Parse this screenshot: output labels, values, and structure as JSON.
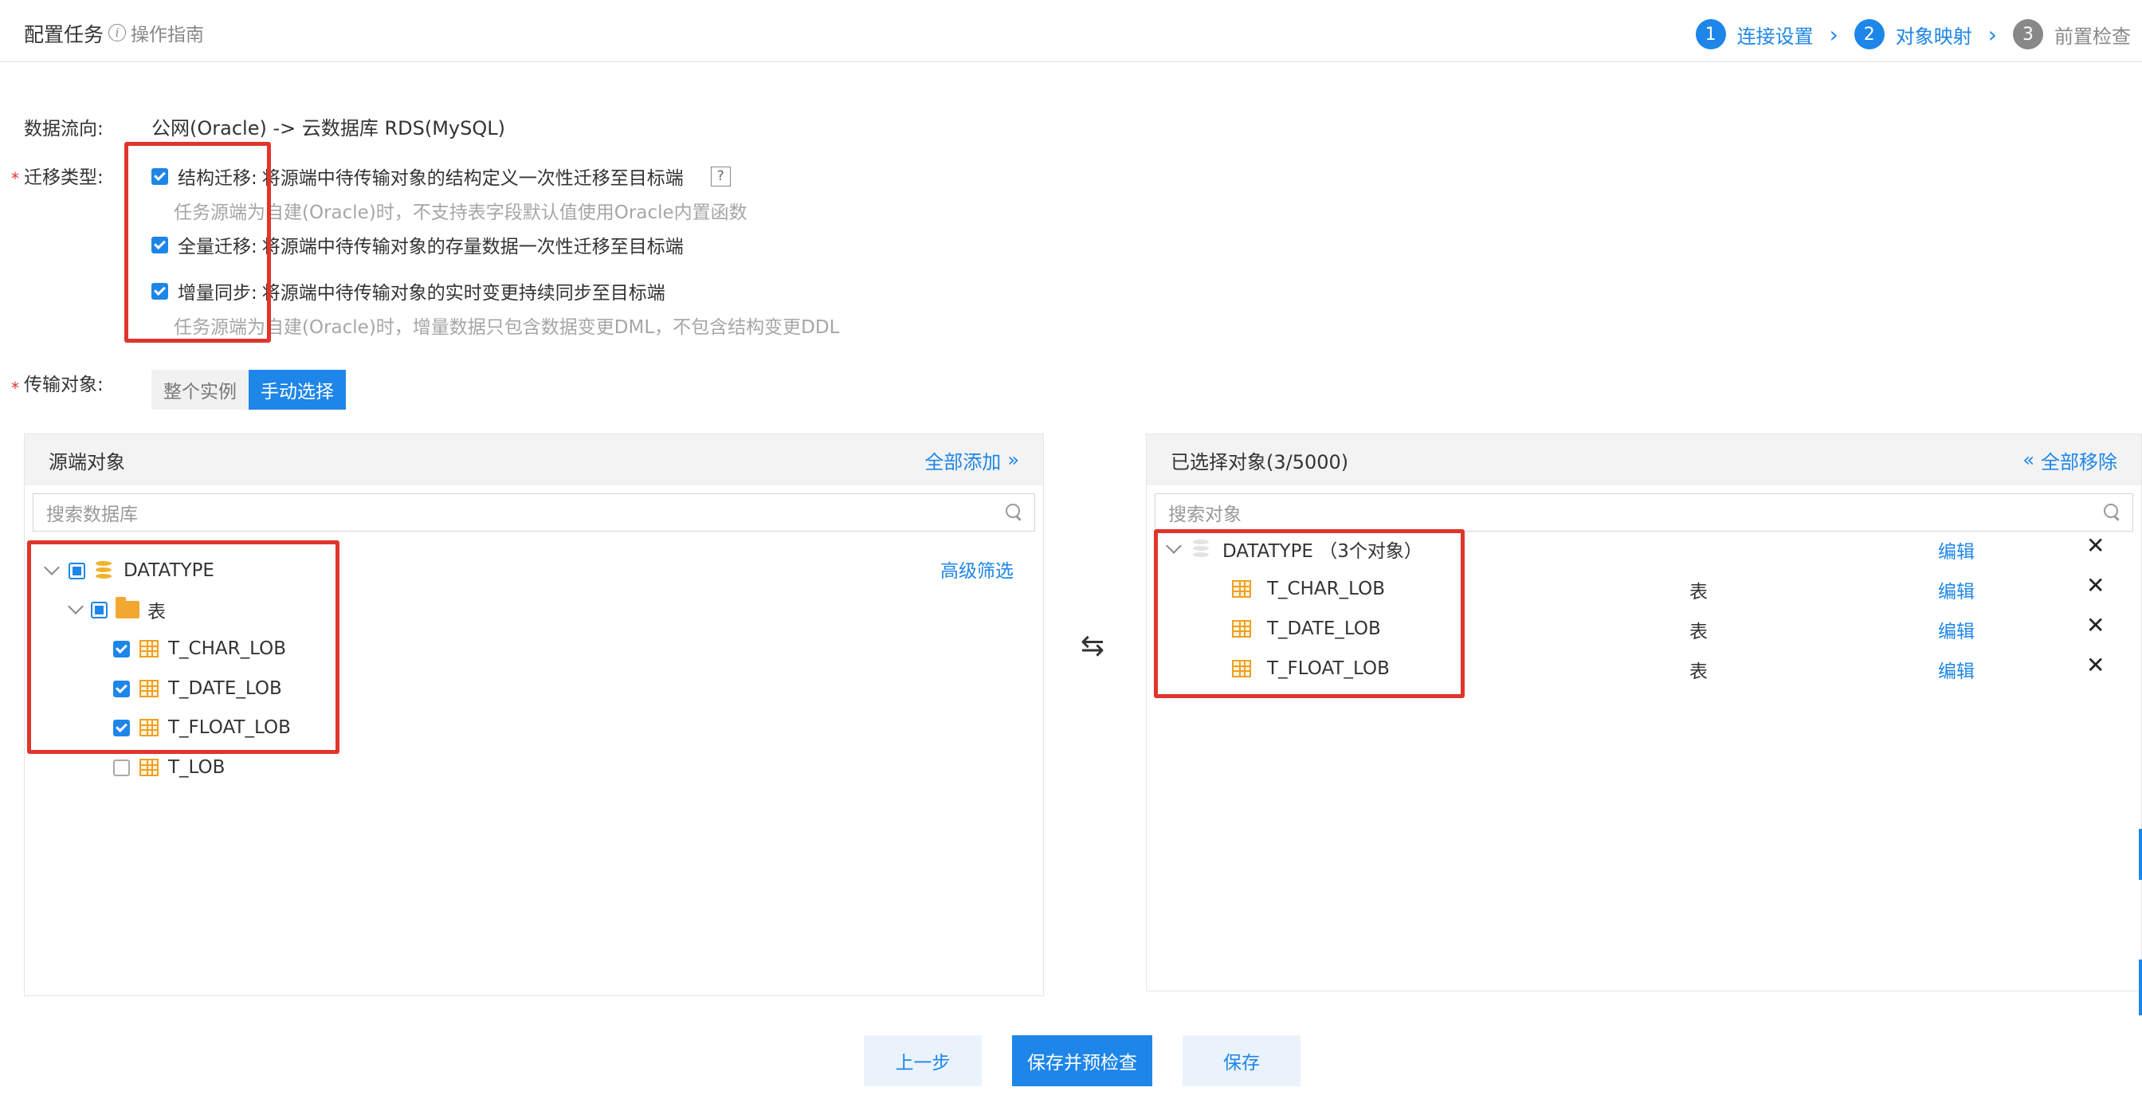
{
  "header": {
    "title": "配置任务",
    "guide": "操作指南",
    "steps": [
      {
        "num": "1",
        "label": "连接设置"
      },
      {
        "num": "2",
        "label": "对象映射"
      },
      {
        "num": "3",
        "label": "前置检查"
      }
    ]
  },
  "form": {
    "flow_label": "数据流向:",
    "flow_value": "公网(Oracle) -> 云数据库 RDS(MySQL)",
    "migration_label": "迁移类型:",
    "options": [
      {
        "label": "结构迁移:",
        "desc": "将源端中待传输对象的结构定义一次性迁移至目标端",
        "hint": "任务源端为自建(Oracle)时，不支持表字段默认值使用Oracle内置函数"
      },
      {
        "label": "全量迁移:",
        "desc": "将源端中待传输对象的存量数据一次性迁移至目标端",
        "hint": ""
      },
      {
        "label": "增量同步:",
        "desc": "将源端中待传输对象的实时变更持续同步至目标端",
        "hint": "任务源端为自建(Oracle)时，增量数据只包含数据变更DML，不包含结构变更DDL"
      }
    ],
    "help_mark": "?",
    "object_label": "传输对象:",
    "object_modes": [
      "整个实例",
      "手动选择"
    ]
  },
  "source": {
    "title": "源端对象",
    "add_all": "全部添加",
    "search_placeholder": "搜索数据库",
    "filter": "高级筛选",
    "db": "DATATYPE",
    "folder": "表",
    "tables": [
      {
        "name": "T_CHAR_LOB",
        "checked": true
      },
      {
        "name": "T_DATE_LOB",
        "checked": true
      },
      {
        "name": "T_FLOAT_LOB",
        "checked": true
      },
      {
        "name": "T_LOB",
        "checked": false
      }
    ]
  },
  "target": {
    "title": "已选择对象(3/5000)",
    "remove_all": "全部移除",
    "search_placeholder": "搜索对象",
    "db": "DATATYPE （3个对象）",
    "edit": "编辑",
    "items": [
      {
        "name": "T_CHAR_LOB",
        "type": "表",
        "edit": "编辑"
      },
      {
        "name": "T_DATE_LOB",
        "type": "表",
        "edit": "编辑"
      },
      {
        "name": "T_FLOAT_LOB",
        "type": "表",
        "edit": "编辑"
      }
    ]
  },
  "footer": {
    "prev": "上一步",
    "save_check": "保存并预检查",
    "save": "保存"
  },
  "colors": {
    "accent": "#1e86e8",
    "highlight_box": "#e0352b",
    "table_icon": "#f0a020"
  }
}
